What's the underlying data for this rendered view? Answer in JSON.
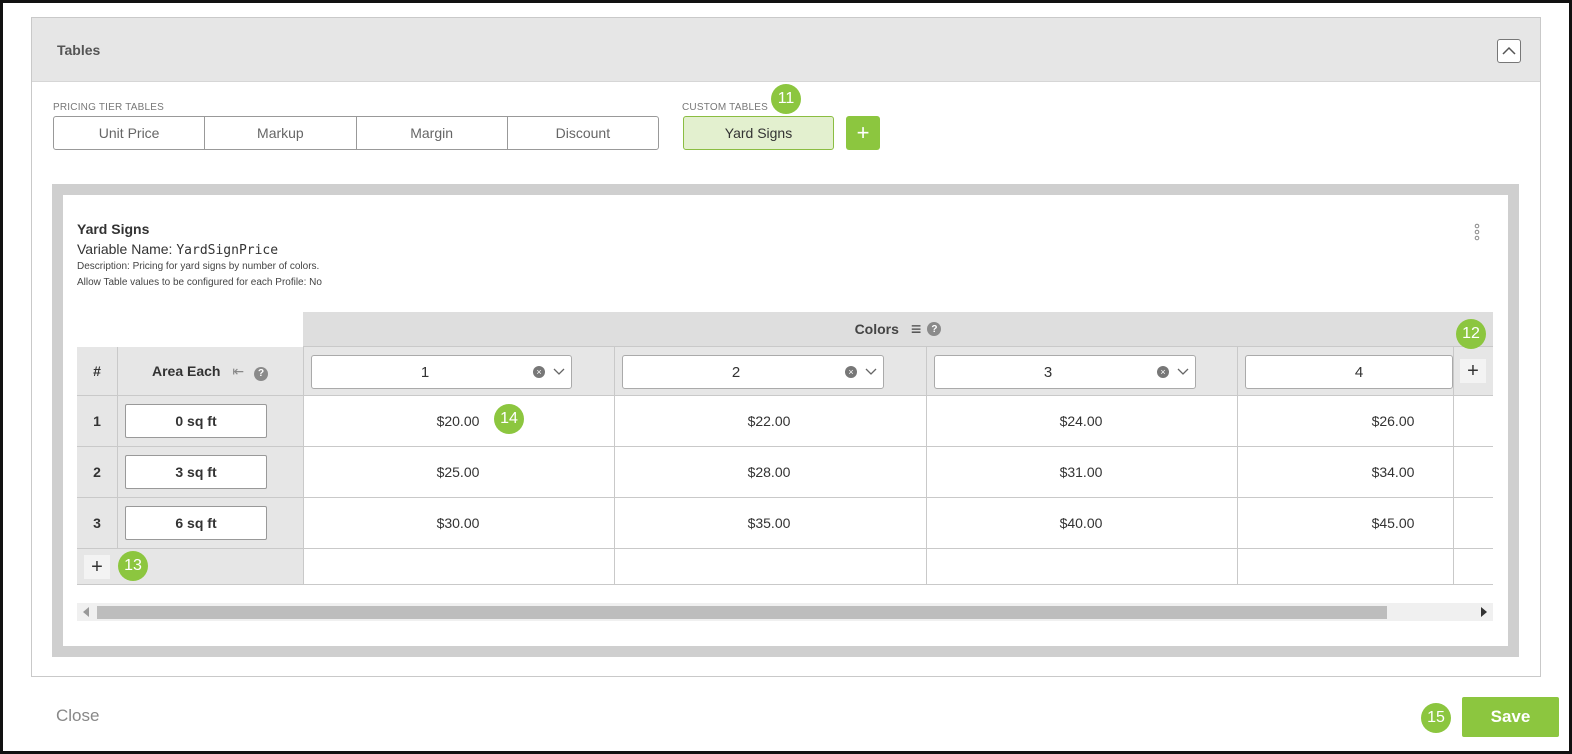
{
  "panel": {
    "title": "Tables"
  },
  "pricing_tiers": {
    "label": "PRICING TIER TABLES",
    "buttons": [
      "Unit Price",
      "Markup",
      "Margin",
      "Discount"
    ]
  },
  "custom_tables": {
    "label": "CUSTOM TABLES",
    "active": "Yard Signs",
    "add_label": "+"
  },
  "badges": {
    "b11": "11",
    "b12": "12",
    "b13": "13",
    "b14": "14",
    "b15": "15"
  },
  "table": {
    "title": "Yard Signs",
    "variable_prefix": "Variable Name: ",
    "variable_name": "YardSignPrice",
    "description": "Description: Pricing for yard signs by number of colors.",
    "profile_config": "Allow Table values to be configured for each Profile:  No",
    "col_group_header": "Colors",
    "hash_header": "#",
    "row_header": "Area Each",
    "help": "?",
    "columns": [
      "1",
      "2",
      "3",
      "4"
    ],
    "rows": [
      {
        "num": "1",
        "area": "0 sq ft",
        "values": [
          "$20.00",
          "$22.00",
          "$24.00",
          "$26.00"
        ]
      },
      {
        "num": "2",
        "area": "3 sq ft",
        "values": [
          "$25.00",
          "$28.00",
          "$31.00",
          "$34.00"
        ]
      },
      {
        "num": "3",
        "area": "6 sq ft",
        "values": [
          "$30.00",
          "$35.00",
          "$40.00",
          "$45.00"
        ]
      }
    ]
  },
  "footer": {
    "close": "Close",
    "save": "Save"
  }
}
